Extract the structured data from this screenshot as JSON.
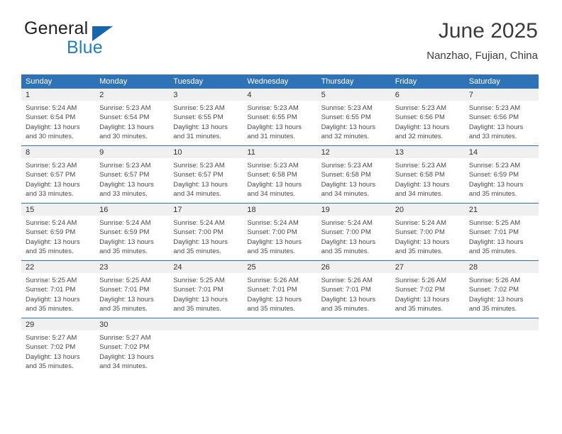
{
  "logo": {
    "word_one": "General",
    "word_two": "Blue",
    "triangle_icon": "blue-triangle-icon",
    "accent_color": "#1566ae",
    "blue_text_color": "#1d7fc4"
  },
  "header": {
    "title": "June 2025",
    "subtitle": "Nanzhao, Fujian, China"
  },
  "theme": {
    "header_blue": "#2e72b8",
    "day_band_gray": "#f0f0f0",
    "text_color": "#333333"
  },
  "calendar": {
    "weekday_headers": [
      "Sunday",
      "Monday",
      "Tuesday",
      "Wednesday",
      "Thursday",
      "Friday",
      "Saturday"
    ],
    "weeks": [
      [
        {
          "day": "1",
          "sunrise": "Sunrise: 5:24 AM",
          "sunset": "Sunset: 6:54 PM",
          "daylight_line1": "Daylight: 13 hours",
          "daylight_line2": "and 30 minutes."
        },
        {
          "day": "2",
          "sunrise": "Sunrise: 5:23 AM",
          "sunset": "Sunset: 6:54 PM",
          "daylight_line1": "Daylight: 13 hours",
          "daylight_line2": "and 30 minutes."
        },
        {
          "day": "3",
          "sunrise": "Sunrise: 5:23 AM",
          "sunset": "Sunset: 6:55 PM",
          "daylight_line1": "Daylight: 13 hours",
          "daylight_line2": "and 31 minutes."
        },
        {
          "day": "4",
          "sunrise": "Sunrise: 5:23 AM",
          "sunset": "Sunset: 6:55 PM",
          "daylight_line1": "Daylight: 13 hours",
          "daylight_line2": "and 31 minutes."
        },
        {
          "day": "5",
          "sunrise": "Sunrise: 5:23 AM",
          "sunset": "Sunset: 6:55 PM",
          "daylight_line1": "Daylight: 13 hours",
          "daylight_line2": "and 32 minutes."
        },
        {
          "day": "6",
          "sunrise": "Sunrise: 5:23 AM",
          "sunset": "Sunset: 6:56 PM",
          "daylight_line1": "Daylight: 13 hours",
          "daylight_line2": "and 32 minutes."
        },
        {
          "day": "7",
          "sunrise": "Sunrise: 5:23 AM",
          "sunset": "Sunset: 6:56 PM",
          "daylight_line1": "Daylight: 13 hours",
          "daylight_line2": "and 33 minutes."
        }
      ],
      [
        {
          "day": "8",
          "sunrise": "Sunrise: 5:23 AM",
          "sunset": "Sunset: 6:57 PM",
          "daylight_line1": "Daylight: 13 hours",
          "daylight_line2": "and 33 minutes."
        },
        {
          "day": "9",
          "sunrise": "Sunrise: 5:23 AM",
          "sunset": "Sunset: 6:57 PM",
          "daylight_line1": "Daylight: 13 hours",
          "daylight_line2": "and 33 minutes."
        },
        {
          "day": "10",
          "sunrise": "Sunrise: 5:23 AM",
          "sunset": "Sunset: 6:57 PM",
          "daylight_line1": "Daylight: 13 hours",
          "daylight_line2": "and 34 minutes."
        },
        {
          "day": "11",
          "sunrise": "Sunrise: 5:23 AM",
          "sunset": "Sunset: 6:58 PM",
          "daylight_line1": "Daylight: 13 hours",
          "daylight_line2": "and 34 minutes."
        },
        {
          "day": "12",
          "sunrise": "Sunrise: 5:23 AM",
          "sunset": "Sunset: 6:58 PM",
          "daylight_line1": "Daylight: 13 hours",
          "daylight_line2": "and 34 minutes."
        },
        {
          "day": "13",
          "sunrise": "Sunrise: 5:23 AM",
          "sunset": "Sunset: 6:58 PM",
          "daylight_line1": "Daylight: 13 hours",
          "daylight_line2": "and 34 minutes."
        },
        {
          "day": "14",
          "sunrise": "Sunrise: 5:23 AM",
          "sunset": "Sunset: 6:59 PM",
          "daylight_line1": "Daylight: 13 hours",
          "daylight_line2": "and 35 minutes."
        }
      ],
      [
        {
          "day": "15",
          "sunrise": "Sunrise: 5:24 AM",
          "sunset": "Sunset: 6:59 PM",
          "daylight_line1": "Daylight: 13 hours",
          "daylight_line2": "and 35 minutes."
        },
        {
          "day": "16",
          "sunrise": "Sunrise: 5:24 AM",
          "sunset": "Sunset: 6:59 PM",
          "daylight_line1": "Daylight: 13 hours",
          "daylight_line2": "and 35 minutes."
        },
        {
          "day": "17",
          "sunrise": "Sunrise: 5:24 AM",
          "sunset": "Sunset: 7:00 PM",
          "daylight_line1": "Daylight: 13 hours",
          "daylight_line2": "and 35 minutes."
        },
        {
          "day": "18",
          "sunrise": "Sunrise: 5:24 AM",
          "sunset": "Sunset: 7:00 PM",
          "daylight_line1": "Daylight: 13 hours",
          "daylight_line2": "and 35 minutes."
        },
        {
          "day": "19",
          "sunrise": "Sunrise: 5:24 AM",
          "sunset": "Sunset: 7:00 PM",
          "daylight_line1": "Daylight: 13 hours",
          "daylight_line2": "and 35 minutes."
        },
        {
          "day": "20",
          "sunrise": "Sunrise: 5:24 AM",
          "sunset": "Sunset: 7:00 PM",
          "daylight_line1": "Daylight: 13 hours",
          "daylight_line2": "and 35 minutes."
        },
        {
          "day": "21",
          "sunrise": "Sunrise: 5:25 AM",
          "sunset": "Sunset: 7:01 PM",
          "daylight_line1": "Daylight: 13 hours",
          "daylight_line2": "and 35 minutes."
        }
      ],
      [
        {
          "day": "22",
          "sunrise": "Sunrise: 5:25 AM",
          "sunset": "Sunset: 7:01 PM",
          "daylight_line1": "Daylight: 13 hours",
          "daylight_line2": "and 35 minutes."
        },
        {
          "day": "23",
          "sunrise": "Sunrise: 5:25 AM",
          "sunset": "Sunset: 7:01 PM",
          "daylight_line1": "Daylight: 13 hours",
          "daylight_line2": "and 35 minutes."
        },
        {
          "day": "24",
          "sunrise": "Sunrise: 5:25 AM",
          "sunset": "Sunset: 7:01 PM",
          "daylight_line1": "Daylight: 13 hours",
          "daylight_line2": "and 35 minutes."
        },
        {
          "day": "25",
          "sunrise": "Sunrise: 5:26 AM",
          "sunset": "Sunset: 7:01 PM",
          "daylight_line1": "Daylight: 13 hours",
          "daylight_line2": "and 35 minutes."
        },
        {
          "day": "26",
          "sunrise": "Sunrise: 5:26 AM",
          "sunset": "Sunset: 7:01 PM",
          "daylight_line1": "Daylight: 13 hours",
          "daylight_line2": "and 35 minutes."
        },
        {
          "day": "27",
          "sunrise": "Sunrise: 5:26 AM",
          "sunset": "Sunset: 7:02 PM",
          "daylight_line1": "Daylight: 13 hours",
          "daylight_line2": "and 35 minutes."
        },
        {
          "day": "28",
          "sunrise": "Sunrise: 5:26 AM",
          "sunset": "Sunset: 7:02 PM",
          "daylight_line1": "Daylight: 13 hours",
          "daylight_line2": "and 35 minutes."
        }
      ],
      [
        {
          "day": "29",
          "sunrise": "Sunrise: 5:27 AM",
          "sunset": "Sunset: 7:02 PM",
          "daylight_line1": "Daylight: 13 hours",
          "daylight_line2": "and 35 minutes."
        },
        {
          "day": "30",
          "sunrise": "Sunrise: 5:27 AM",
          "sunset": "Sunset: 7:02 PM",
          "daylight_line1": "Daylight: 13 hours",
          "daylight_line2": "and 34 minutes."
        },
        {
          "day": "",
          "sunrise": "",
          "sunset": "",
          "daylight_line1": "",
          "daylight_line2": ""
        },
        {
          "day": "",
          "sunrise": "",
          "sunset": "",
          "daylight_line1": "",
          "daylight_line2": ""
        },
        {
          "day": "",
          "sunrise": "",
          "sunset": "",
          "daylight_line1": "",
          "daylight_line2": ""
        },
        {
          "day": "",
          "sunrise": "",
          "sunset": "",
          "daylight_line1": "",
          "daylight_line2": ""
        },
        {
          "day": "",
          "sunrise": "",
          "sunset": "",
          "daylight_line1": "",
          "daylight_line2": ""
        }
      ]
    ]
  }
}
